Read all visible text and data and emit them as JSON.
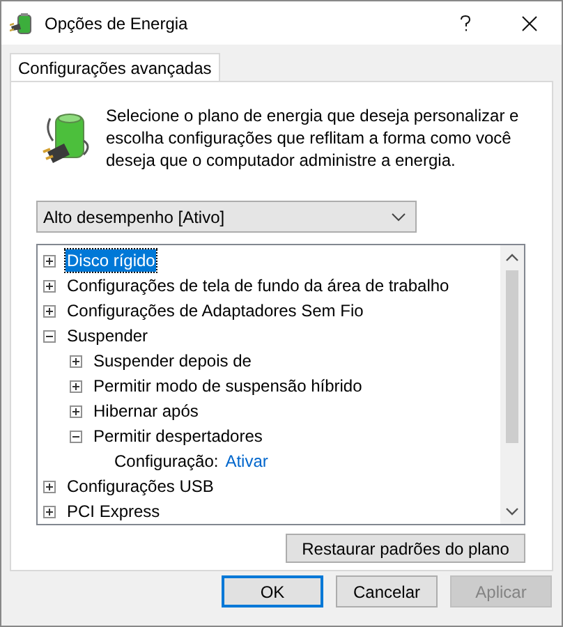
{
  "window": {
    "title": "Opções de Energia"
  },
  "tabs": [
    {
      "label": "Configurações avançadas",
      "selected": true
    }
  ],
  "description": "Selecione o plano de energia que deseja personalizar e escolha configurações que reflitam a forma como você deseja que o computador administre a energia.",
  "plan_dropdown": {
    "value": "Alto desempenho [Ativo]"
  },
  "tree": [
    {
      "kind": "group",
      "label": "Disco rígido",
      "expanded": false,
      "selected": true
    },
    {
      "kind": "group",
      "label": "Configurações de tela de fundo da área de trabalho",
      "expanded": false,
      "selected": false
    },
    {
      "kind": "group",
      "label": "Configurações de Adaptadores Sem Fio",
      "expanded": false,
      "selected": false
    },
    {
      "kind": "group",
      "label": "Suspender",
      "expanded": true,
      "selected": false,
      "children": [
        {
          "kind": "group",
          "label": "Suspender depois de",
          "expanded": false,
          "selected": false
        },
        {
          "kind": "group",
          "label": "Permitir modo de suspensão híbrido",
          "expanded": false,
          "selected": false
        },
        {
          "kind": "group",
          "label": "Hibernar após",
          "expanded": false,
          "selected": false
        },
        {
          "kind": "group",
          "label": "Permitir despertadores",
          "expanded": true,
          "selected": false,
          "children": [
            {
              "kind": "setting",
              "label": "Configuração:",
              "value": "Ativar"
            }
          ]
        }
      ]
    },
    {
      "kind": "group",
      "label": "Configurações USB",
      "expanded": false,
      "selected": false
    },
    {
      "kind": "group",
      "label": "PCI Express",
      "expanded": false,
      "selected": false
    }
  ],
  "restore_button": "Restaurar padrões do plano",
  "buttons": [
    {
      "label": "OK",
      "default": true,
      "disabled": false
    },
    {
      "label": "Cancelar",
      "default": false,
      "disabled": false
    },
    {
      "label": "Aplicar",
      "default": false,
      "disabled": true
    }
  ]
}
